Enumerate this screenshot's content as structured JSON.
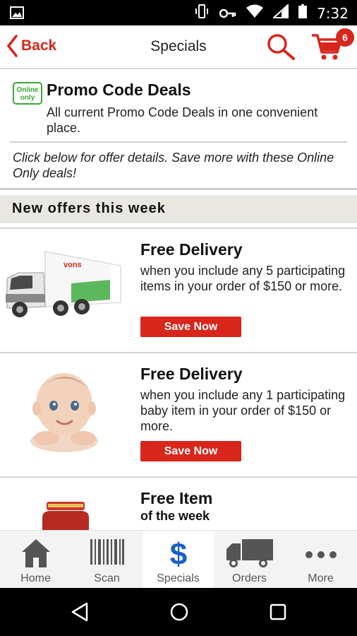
{
  "status_bar": {
    "time": "7:32"
  },
  "app_bar": {
    "back_label": "Back",
    "title": "Specials",
    "cart_count": "6"
  },
  "promo": {
    "logo_text": "Online only",
    "title": "Promo Code Deals",
    "description": "All current Promo Code Deals in one convenient place.",
    "note": "Click below for offer details. Save more with these Online Only deals!"
  },
  "section_title": "New offers this week",
  "offers": [
    {
      "title": "Free Delivery",
      "description": "when you include any 5 participating items in your order of $150 or more.",
      "button": "Save Now",
      "image": "delivery-truck-image",
      "truck_brand": "vons"
    },
    {
      "title": "Free Delivery",
      "description": "when you include any 1 participating baby item in your order of $150 or more.",
      "button": "Save Now",
      "image": "baby-image"
    },
    {
      "title": "Free Item",
      "subtitle": "of the week",
      "image": "jar-image"
    }
  ],
  "tabs": [
    {
      "label": "Home",
      "icon": "house-icon"
    },
    {
      "label": "Scan",
      "icon": "barcode-icon"
    },
    {
      "label": "Specials",
      "icon": "dollar-icon",
      "active": true
    },
    {
      "label": "Orders",
      "icon": "truck-icon"
    },
    {
      "label": "More",
      "icon": "more-dots-icon"
    }
  ],
  "colors": {
    "accent": "#d8261c",
    "active_tab": "#1a5fc6",
    "online_green": "#3aa935",
    "section_bg": "#e9e7e1"
  }
}
